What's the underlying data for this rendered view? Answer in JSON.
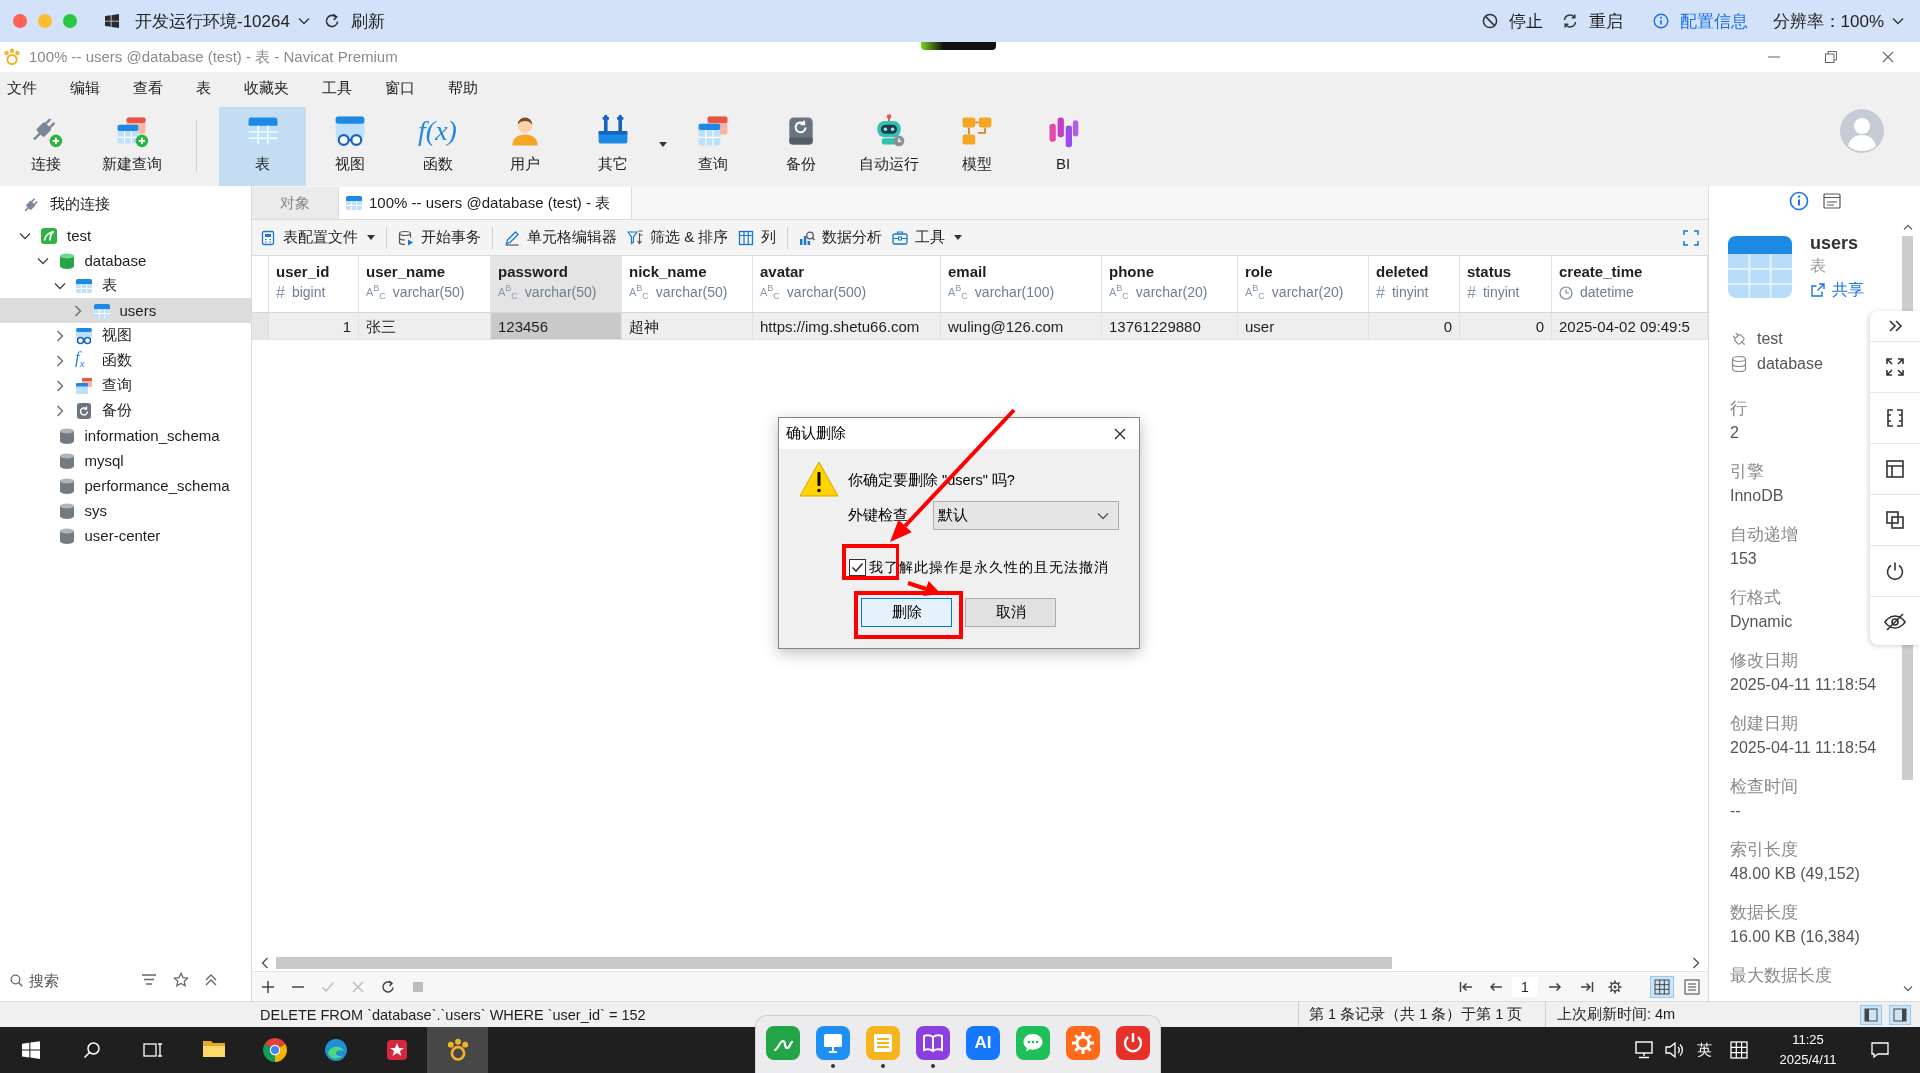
{
  "system_bar": {
    "environment": "开发运行环境-10264",
    "refresh": "刷新",
    "actions": [
      {
        "kind": "stop",
        "label": "停止"
      },
      {
        "kind": "restart",
        "label": "重启"
      },
      {
        "kind": "info",
        "label": "配置信息"
      }
    ],
    "resolution": "分辨率：100%"
  },
  "window": {
    "title": "100% -- users @database (test) - 表 - Navicat Premium"
  },
  "menu": [
    "文件",
    "编辑",
    "查看",
    "表",
    "收藏夹",
    "工具",
    "窗口",
    "帮助"
  ],
  "toolbar": {
    "groups": [
      [
        {
          "kind": "connect",
          "label": "连接",
          "selected": false,
          "dropdown": false
        },
        {
          "kind": "newquery",
          "label": "新建查询",
          "selected": false,
          "dropdown": false
        }
      ],
      [
        {
          "kind": "table",
          "label": "表",
          "selected": true,
          "dropdown": false
        },
        {
          "kind": "view",
          "label": "视图",
          "selected": false,
          "dropdown": false
        },
        {
          "kind": "function",
          "label": "函数",
          "glyph": "f(x)",
          "selected": false,
          "dropdown": false
        },
        {
          "kind": "user",
          "label": "用户",
          "selected": false,
          "dropdown": false
        },
        {
          "kind": "other",
          "label": "其它",
          "selected": false,
          "dropdown": true
        },
        {
          "kind": "query",
          "label": "查询",
          "selected": false,
          "dropdown": false
        },
        {
          "kind": "backup",
          "label": "备份",
          "selected": false,
          "dropdown": false
        },
        {
          "kind": "automation",
          "label": "自动运行",
          "selected": false,
          "dropdown": false
        },
        {
          "kind": "model",
          "label": "模型",
          "selected": false,
          "dropdown": false
        },
        {
          "kind": "bi",
          "label": "BI",
          "selected": false,
          "dropdown": false
        }
      ]
    ]
  },
  "sidebar": {
    "title": "我的连接",
    "tree": [
      {
        "label": "test",
        "kind": "connection",
        "expanded": true,
        "selected": false,
        "children": [
          {
            "label": "database",
            "kind": "database",
            "opened": true,
            "expanded": true,
            "selected": false,
            "children": [
              {
                "label": "表",
                "kind": "tables",
                "expanded": true,
                "selected": false,
                "children": [
                  {
                    "label": "users",
                    "kind": "table",
                    "expanded": false,
                    "selected": true
                  }
                ]
              },
              {
                "label": "视图",
                "kind": "views",
                "expanded": false,
                "selected": false
              },
              {
                "label": "函数",
                "kind": "functions",
                "glyph": "f$_{x}$",
                "expanded": false,
                "selected": false
              },
              {
                "label": "查询",
                "kind": "queries",
                "expanded": false,
                "selected": false
              },
              {
                "label": "备份",
                "kind": "backups",
                "expanded": false,
                "selected": false
              }
            ]
          },
          {
            "label": "information_schema",
            "kind": "database",
            "opened": false,
            "selected": false
          },
          {
            "label": "mysql",
            "kind": "database",
            "opened": false,
            "selected": false
          },
          {
            "label": "performance_schema",
            "kind": "database",
            "opened": false,
            "selected": false
          },
          {
            "label": "sys",
            "kind": "database",
            "opened": false,
            "selected": false
          },
          {
            "label": "user-center",
            "kind": "database",
            "opened": false,
            "selected": false
          }
        ]
      }
    ],
    "search": {
      "placeholder": "搜索"
    }
  },
  "tabs": [
    {
      "kind": "objects",
      "label": "对象",
      "selected": false
    },
    {
      "kind": "table",
      "label": "100% -- users @database (test) - 表",
      "selected": true
    }
  ],
  "table_toolbar": {
    "groups": [
      [
        {
          "kind": "profile",
          "label": "表配置文件",
          "dropdown": true
        }
      ],
      [
        {
          "kind": "transaction",
          "label": "开始事务",
          "dropdown": false
        }
      ],
      [
        {
          "kind": "editor",
          "label": "单元格编辑器",
          "dropdown": false
        },
        {
          "kind": "filter",
          "label": "筛选 & 排序",
          "dropdown": false
        },
        {
          "kind": "columns",
          "label": "列",
          "dropdown": false
        }
      ],
      [
        {
          "kind": "analysis",
          "label": "数据分析",
          "dropdown": false
        },
        {
          "kind": "tools",
          "label": "工具",
          "dropdown": true
        }
      ]
    ]
  },
  "table": {
    "columns": [
      {
        "name": "user_id",
        "kind": "number",
        "symbol": "#",
        "type": "bigint",
        "selected": false
      },
      {
        "name": "user_name",
        "kind": "text",
        "symbol": "A$^{B}$$_{C}$",
        "type": "varchar(50)",
        "selected": false
      },
      {
        "name": "password",
        "kind": "text",
        "symbol": "A$^{B}$$_{C}$",
        "type": "varchar(50)",
        "selected": true
      },
      {
        "name": "nick_name",
        "kind": "text",
        "symbol": "A$^{B}$$_{C}$",
        "type": "varchar(50)",
        "selected": false
      },
      {
        "name": "avatar",
        "kind": "text",
        "symbol": "A$^{B}$$_{C}$",
        "type": "varchar(500)",
        "selected": false
      },
      {
        "name": "email",
        "kind": "text",
        "symbol": "A$^{B}$$_{C}$",
        "type": "varchar(100)",
        "selected": false
      },
      {
        "name": "phone",
        "kind": "text",
        "symbol": "A$^{B}$$_{C}$",
        "type": "varchar(20)",
        "selected": false
      },
      {
        "name": "role",
        "kind": "text",
        "symbol": "A$^{B}$$_{C}$",
        "type": "varchar(20)",
        "selected": false
      },
      {
        "name": "deleted",
        "kind": "number",
        "symbol": "#",
        "type": "tinyint",
        "selected": false
      },
      {
        "name": "status",
        "kind": "number",
        "symbol": "#",
        "type": "tinyint",
        "selected": false
      },
      {
        "name": "create_time",
        "kind": "datetime",
        "type": "datetime",
        "selected": false
      }
    ],
    "rows": [
      {
        "selected": true,
        "cells": [
          "1",
          "张三",
          "123456",
          "超神",
          "https://img.shetu66.com",
          "wuling@126.com",
          "13761229880",
          "user",
          "0",
          "0",
          "2025-04-02 09:49:5"
        ]
      }
    ]
  },
  "edit_actions": [
    {
      "kind": "add",
      "disabled": false
    },
    {
      "kind": "remove",
      "disabled": false
    },
    {
      "kind": "apply",
      "disabled": true
    },
    {
      "kind": "discard",
      "disabled": true
    },
    {
      "kind": "refresh",
      "disabled": false
    },
    {
      "kind": "stop",
      "disabled": true
    }
  ],
  "pager": {
    "page": "1",
    "views": [
      {
        "kind": "grid",
        "selected": true
      },
      {
        "kind": "form",
        "selected": false
      }
    ]
  },
  "info_panel": {
    "name": "users",
    "type": "表",
    "share": "共享",
    "connection": "test",
    "database": "database",
    "properties": [
      {
        "label": "行",
        "value": "2"
      },
      {
        "label": "引擎",
        "value": "InnoDB"
      },
      {
        "label": "自动递增",
        "value": "153"
      },
      {
        "label": "行格式",
        "value": "Dynamic"
      },
      {
        "label": "修改日期",
        "value": "2025-04-11 11:18:54"
      },
      {
        "label": "创建日期",
        "value": "2025-04-11 11:18:54"
      },
      {
        "label": "检查时间",
        "value": "--"
      },
      {
        "label": "索引长度",
        "value": "48.00 KB (49,152)"
      },
      {
        "label": "数据长度",
        "value": "16.00 KB (16,384)"
      },
      {
        "label": "最大数据长度"
      }
    ]
  },
  "dialog": {
    "title": "确认删除",
    "message": "你确定要删除 \"users\" 吗?",
    "foreign_key_label": "外键检查",
    "foreign_key_value": "默认",
    "confirm": {
      "label": "我了解此操作是永久性的且无法撤消",
      "checked": true,
      "highlighted": true
    },
    "buttons": [
      {
        "label": "删除",
        "default": true,
        "highlighted": true
      },
      {
        "label": "取消",
        "default": false,
        "highlighted": false
      }
    ]
  },
  "status_bar": {
    "sql": "DELETE FROM `database`.`users` WHERE `user_id` = 152",
    "records": "第 1 条记录（共 1 条）于第 1 页",
    "refresh_time": "上次刷新时间: 4m",
    "panels": [
      {
        "kind": "left",
        "on": true
      },
      {
        "kind": "right",
        "on": true
      }
    ]
  },
  "dock": [
    {
      "kind": "pen",
      "running": false
    },
    {
      "kind": "monitor",
      "running": true
    },
    {
      "kind": "list",
      "running": true
    },
    {
      "kind": "book",
      "running": true
    },
    {
      "kind": "ai",
      "label": "AI",
      "running": false
    },
    {
      "kind": "chat",
      "running": false
    },
    {
      "kind": "gear",
      "running": false
    },
    {
      "kind": "power",
      "running": false
    }
  ],
  "taskbar": {
    "apps": [
      {
        "kind": "folder",
        "active": false
      },
      {
        "kind": "chrome",
        "active": false
      },
      {
        "kind": "edge",
        "active": false
      },
      {
        "kind": "star",
        "active": false
      },
      {
        "kind": "navicat",
        "active": true
      }
    ],
    "ime": "英",
    "time": "11:25",
    "date": "2025/4/11"
  }
}
